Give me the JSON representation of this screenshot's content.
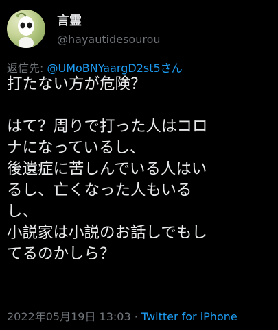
{
  "author": {
    "display_name": "言霊",
    "handle": "@hayautidesourou"
  },
  "reply": {
    "prefix": "返信先: ",
    "mention": "@UMoBNYaargD2st5さん"
  },
  "tweet": {
    "lines": [
      "打たない方が危険？",
      "",
      "はて？周りで打った人はコロ",
      "ナになっているし、",
      "後遺症に苦しんでいる人はい",
      "るし、亡くなった人もいる",
      "し、",
      "小説家は小説のお話しでもし",
      "てるのかしら？"
    ]
  },
  "meta": {
    "date": "2022年05月19日 13:03",
    "separator": " · ",
    "source": "Twitter for iPhone"
  },
  "colors": {
    "background": "#000000",
    "text": "#e7e9ea",
    "secondary": "#71767b",
    "link": "#1d9bf0"
  }
}
